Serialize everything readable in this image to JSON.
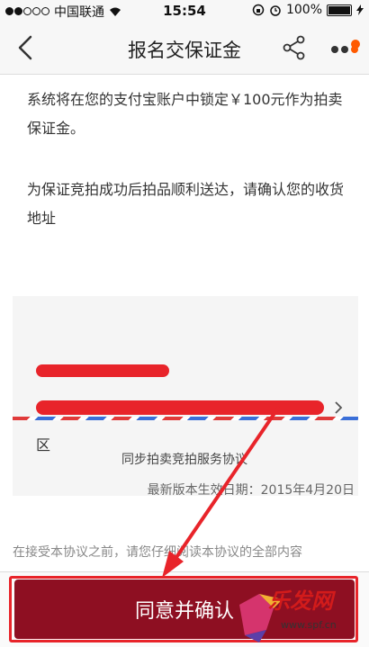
{
  "status_bar": {
    "carrier": "中国联通",
    "time": "15:54",
    "battery": "100%"
  },
  "nav": {
    "title": "报名交保证金"
  },
  "content": {
    "lock_notice": "系统将在您的支付宝账户中锁定￥100元作为拍卖保证金。",
    "address_prompt": "为保证竞拍成功后拍品顺利送达，请确认您的收货地址",
    "address_district": "区",
    "agreement_title": "同步拍卖竞拍服务协议",
    "effective_date": "最新版本生效日期：2015年4月20日",
    "agreement_cut_text": "在接受本协议之前，请您仔细阅读本协议的全部内容"
  },
  "footer": {
    "confirm_label": "同意并确认"
  },
  "watermark": {
    "brand_text": "乐发网",
    "url": "www.spf.cn"
  },
  "colors": {
    "accent_red": "#e8242a",
    "button_dark_red": "#8e0f22",
    "badge_orange": "#ff5a00"
  },
  "icons": [
    "back-chevron-icon",
    "share-icon",
    "more-dots-icon",
    "wifi-icon",
    "lock-rotation-icon",
    "alarm-icon",
    "battery-icon",
    "chevron-right-icon"
  ]
}
